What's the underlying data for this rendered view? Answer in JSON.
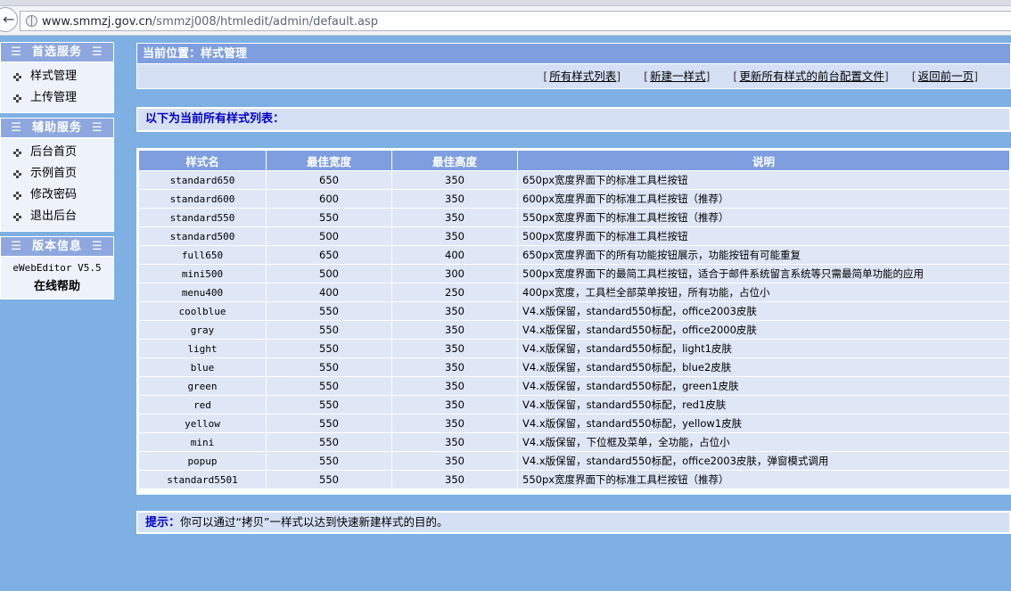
{
  "browser": {
    "url_host": "www.smmzj.gov.cn",
    "url_path": "/smmzj008/htmledit/admin/default.asp"
  },
  "sidebar": {
    "sections": [
      {
        "title": "首选服务",
        "items": [
          "样式管理",
          "上传管理"
        ]
      },
      {
        "title": "辅助服务",
        "items": [
          "后台首页",
          "示例首页",
          "修改密码",
          "退出后台"
        ]
      }
    ],
    "version": {
      "title": "版本信息",
      "name": "eWebEditor V5.5",
      "help": "在线帮助"
    }
  },
  "main": {
    "position": "当前位置：样式管理",
    "links": [
      "所有样式列表",
      "新建一样式",
      "更新所有样式的前台配置文件",
      "返回前一页"
    ],
    "list_title": "以下为当前所有样式列表：",
    "table": {
      "headers": [
        "样式名",
        "最佳宽度",
        "最佳高度",
        "说明"
      ],
      "rows": [
        [
          "standard650",
          "650",
          "350",
          "650px宽度界面下的标准工具栏按钮"
        ],
        [
          "standard600",
          "600",
          "350",
          "600px宽度界面下的标准工具栏按钮（推荐）"
        ],
        [
          "standard550",
          "550",
          "350",
          "550px宽度界面下的标准工具栏按钮（推荐）"
        ],
        [
          "standard500",
          "500",
          "350",
          "500px宽度界面下的标准工具栏按钮"
        ],
        [
          "full650",
          "650",
          "400",
          "650px宽度界面下的所有功能按钮展示，功能按钮有可能重复"
        ],
        [
          "mini500",
          "500",
          "300",
          "500px宽度界面下的最简工具栏按钮，适合于邮件系统留言系统等只需最简单功能的应用"
        ],
        [
          "menu400",
          "400",
          "250",
          "400px宽度，工具栏全部菜单按钮，所有功能，占位小"
        ],
        [
          "coolblue",
          "550",
          "350",
          "V4.x版保留，standard550标配，office2003皮肤"
        ],
        [
          "gray",
          "550",
          "350",
          "V4.x版保留，standard550标配，office2000皮肤"
        ],
        [
          "light",
          "550",
          "350",
          "V4.x版保留，standard550标配，light1皮肤"
        ],
        [
          "blue",
          "550",
          "350",
          "V4.x版保留，standard550标配，blue2皮肤"
        ],
        [
          "green",
          "550",
          "350",
          "V4.x版保留，standard550标配，green1皮肤"
        ],
        [
          "red",
          "550",
          "350",
          "V4.x版保留，standard550标配，red1皮肤"
        ],
        [
          "yellow",
          "550",
          "350",
          "V4.x版保留，standard550标配，yellow1皮肤"
        ],
        [
          "mini",
          "550",
          "350",
          "V4.x版保留，下位框及菜单，全功能，占位小"
        ],
        [
          "popup",
          "550",
          "350",
          "V4.x版保留，standard550标配，office2003皮肤，弹窗模式调用"
        ],
        [
          "standard5501",
          "550",
          "350",
          "550px宽度界面下的标准工具栏按钮（推荐）"
        ]
      ]
    },
    "tip_label": "提示：",
    "tip_text": "你可以通过“拷贝”一样式以达到快速新建样式的目的。"
  },
  "colors": {
    "background": "#7eb0e3",
    "header_blue": "#7e9ee0",
    "row_bg": "#dfe6f6",
    "title_blue": "#0000cc"
  }
}
